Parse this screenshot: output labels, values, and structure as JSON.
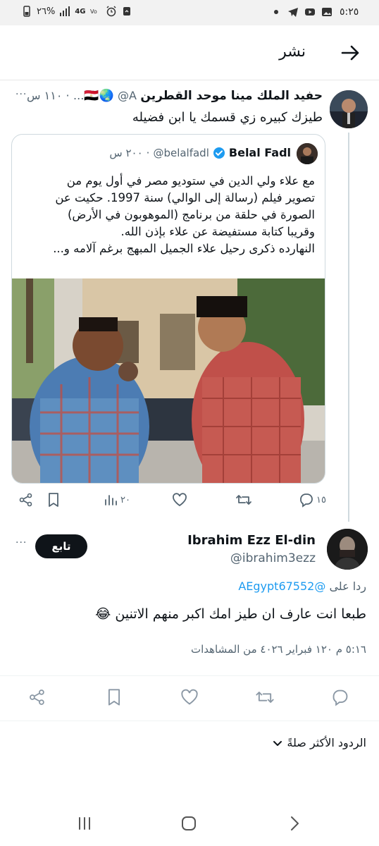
{
  "status_bar": {
    "time": "٥:٢٥",
    "battery_percent": "٢٦%",
    "network": "4G",
    "icons": [
      "dot-icon",
      "telegram-icon",
      "youtube-icon",
      "gallery-icon",
      "alarm-icon",
      "lte-icon",
      "signal-icon",
      "battery-icon"
    ]
  },
  "header": {
    "title": "نشر",
    "back_icon": "arrow-right-icon"
  },
  "parent_tweet": {
    "name": "حفيد الملك مينا موحد القطرين",
    "flags": "🇪🇬🌏",
    "handle": "@A...",
    "time": "١١٠ س",
    "text": "طيزك كبيره زي قسمك يا ابن فضيله",
    "more": "···"
  },
  "quoted_tweet": {
    "name": "Belal Fadl",
    "handle": "@belalfadl",
    "time": "٢٠٠ س",
    "lines": [
      "مع علاء ولي الدين في ستوديو مصر في أول يوم من",
      "تصوير فيلم (رسالة إلى الوالي) سنة 1997. حكيت عن",
      "الصورة في حلقة من برنامج (الموهوبون في الأرض)",
      "وقريبا كتابة مستفيضة عن علاء بإذن الله.",
      "النهارده ذكرى رحيل علاء الجميل المبهج برغم آلامه و..."
    ]
  },
  "parent_actions": {
    "replies": "١٥",
    "views": "٢٠",
    "icons": [
      "reply-icon",
      "retweet-icon",
      "like-icon",
      "views-icon",
      "bookmark-icon",
      "share-icon"
    ]
  },
  "reply_tweet": {
    "name": "Ibrahim Ezz El-din",
    "handle": "@ibrahim3ezz",
    "follow_label": "تابع",
    "more": "···",
    "reply_to_prefix": "ردا على",
    "reply_to_handle": "@AEgypt67552",
    "text": "طبعا انت عارف ان طيز امك اكبر منهم الاتنين 😂",
    "meta": "٥:١٦ م ١٢٠ فبراير ٤٠٢٦ من المشاهدات"
  },
  "sort": {
    "label": "الردود الأكثر صلةً"
  },
  "colors": {
    "link": "#1d9bf0",
    "text": "#0f1419",
    "secondary": "#536471",
    "border": "#cfd9de"
  }
}
